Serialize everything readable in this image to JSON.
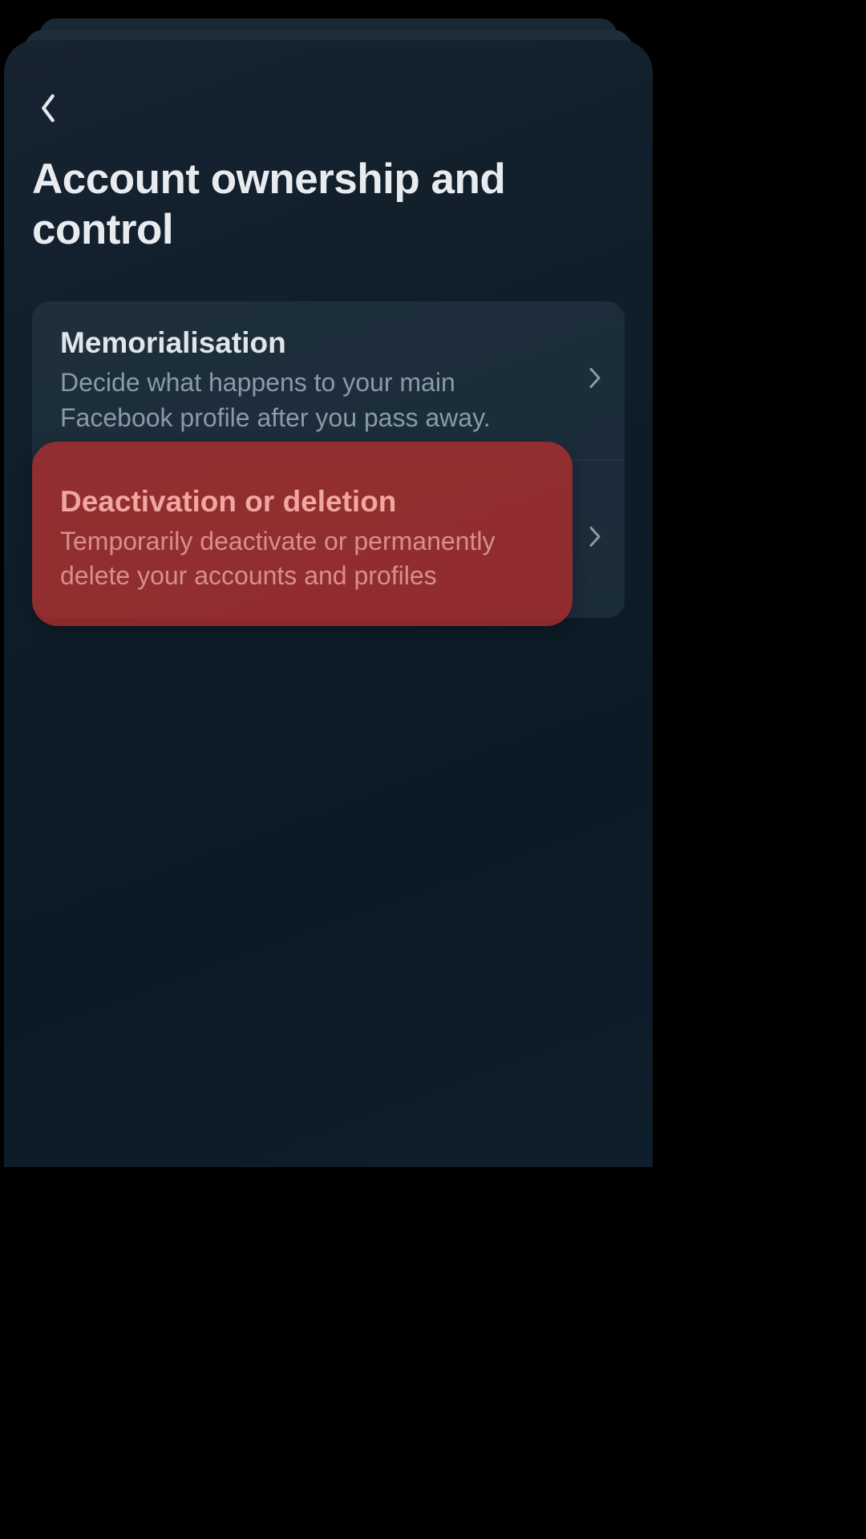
{
  "page": {
    "title": "Account ownership and control"
  },
  "options": [
    {
      "title": "Memorialisation",
      "description": "Decide what happens to your main Facebook profile after you pass away.",
      "highlighted": false
    },
    {
      "title": "Deactivation or deletion",
      "description": "Temporarily deactivate or permanently delete your accounts and profiles",
      "highlighted": true
    }
  ]
}
